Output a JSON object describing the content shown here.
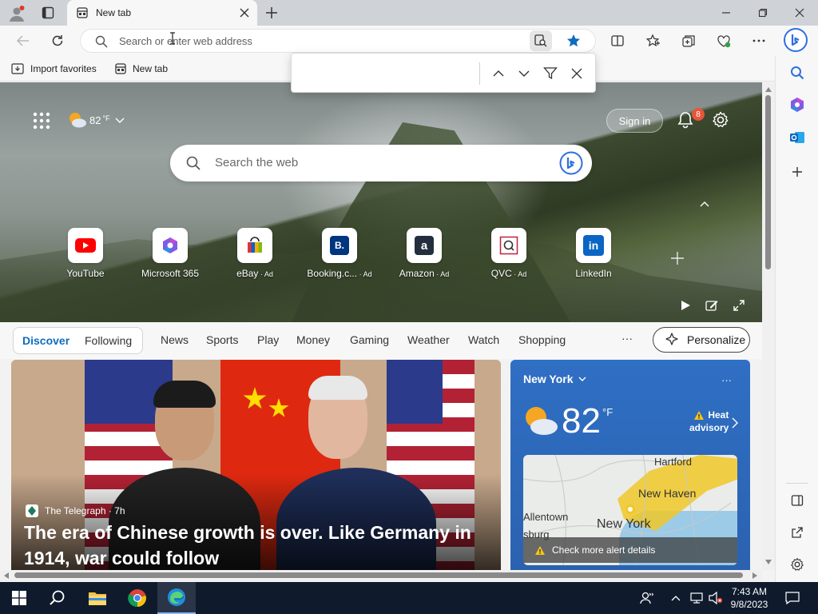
{
  "browser": {
    "tab_title": "New tab",
    "address_placeholder": "Search or enter web address",
    "favorites": [
      {
        "label": "Import favorites"
      },
      {
        "label": "New tab"
      }
    ]
  },
  "hero": {
    "weather_temp": "82",
    "weather_unit": "°F",
    "signin_label": "Sign in",
    "notification_count": "8",
    "search_placeholder": "Search the web",
    "tiles": [
      {
        "label": "YouTube",
        "ad": ""
      },
      {
        "label": "Microsoft 365",
        "ad": ""
      },
      {
        "label": "eBay",
        "ad": " · Ad"
      },
      {
        "label": "Booking.c...",
        "ad": " · Ad"
      },
      {
        "label": "Amazon",
        "ad": " · Ad"
      },
      {
        "label": "QVC",
        "ad": " · Ad"
      },
      {
        "label": "LinkedIn",
        "ad": ""
      }
    ],
    "tile_glyphs": {
      "booking": "B.",
      "amazon": "a",
      "linkedin": "in"
    }
  },
  "feed": {
    "pill_tabs": [
      "Discover",
      "Following"
    ],
    "nav": [
      "News",
      "Sports",
      "Play",
      "Money",
      "Gaming",
      "Weather",
      "Watch",
      "Shopping"
    ],
    "more": "···",
    "personalize": "Personalize"
  },
  "news": {
    "source": "The Telegraph · 7h",
    "title": "The era of Chinese growth is over. Like Germany in 1914, war could follow"
  },
  "weather_card": {
    "location": "New York",
    "temp": "82",
    "unit": "°F",
    "alert_line1": "Heat",
    "alert_line2": "advisory",
    "map_labels": [
      "Hartford",
      "New Haven",
      "Allentown",
      "New York",
      "sburg"
    ],
    "check_alert": "Check more alert details",
    "more": "···"
  },
  "taskbar": {
    "time": "7:43 AM",
    "date": "9/8/2023"
  },
  "colors": {
    "accent": "#0f6cbd",
    "weather_card": "#2f6fc4",
    "taskbar": "#0f1b2d"
  }
}
